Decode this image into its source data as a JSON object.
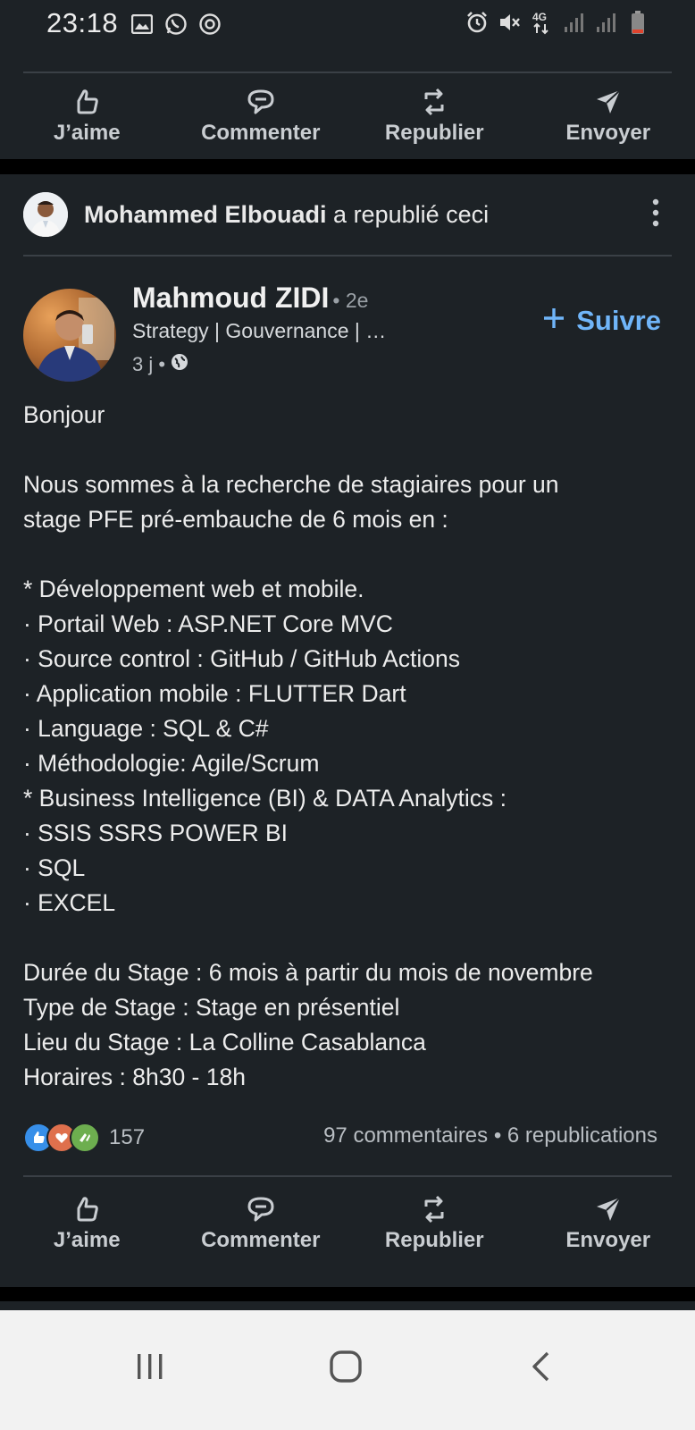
{
  "status_bar": {
    "time": "23:18",
    "left_icons": [
      "gallery-icon",
      "whatsapp-icon",
      "sync-icon"
    ],
    "right_icons": [
      "alarm-icon",
      "mute-icon",
      "4g-icon",
      "signal-icon",
      "signal-icon",
      "battery-icon"
    ],
    "network": "4G"
  },
  "top_actions": [
    {
      "label": "J’aime",
      "icon": "like-icon"
    },
    {
      "label": "Commenter",
      "icon": "comment-icon"
    },
    {
      "label": "Republier",
      "icon": "repost-icon"
    },
    {
      "label": "Envoyer",
      "icon": "send-icon"
    }
  ],
  "post": {
    "reposter_name": "Mohammed Elbouadi",
    "repost_text": "a republié ceci",
    "author_name": "Mahmoud ZIDI",
    "degree": "• 2e",
    "headline": "Strategy | Gouvernance | …",
    "age": "3 j •",
    "follow_label": "Suivre",
    "body": [
      "Bonjour",
      "",
      "Nous sommes à la recherche de stagiaires pour un",
      "stage PFE pré-embauche de 6 mois en :",
      "",
      "* Développement web et mobile.",
      "· Portail Web : ASP.NET Core MVC",
      "· Source control : GitHub / GitHub Actions",
      "· Application mobile : FLUTTER Dart",
      "· Language : SQL & C#",
      "· Méthodologie: Agile/Scrum",
      "* Business Intelligence (BI) & DATA Analytics :",
      "· SSIS SSRS POWER BI",
      "· SQL",
      "· EXCEL",
      "",
      "Durée du Stage : 6 mois à partir du mois de novembre",
      "Type de Stage : Stage en présentiel",
      "Lieu du Stage : La Colline Casablanca",
      "Horaires : 8h30 - 18h"
    ],
    "reaction_count": "157",
    "engagement": "97 commentaires • 6 republications"
  },
  "post_actions": [
    {
      "label": "J’aime",
      "icon": "like-icon"
    },
    {
      "label": "Commenter",
      "icon": "comment-icon"
    },
    {
      "label": "Republier",
      "icon": "repost-icon"
    },
    {
      "label": "Envoyer",
      "icon": "send-icon"
    }
  ],
  "nav_bar": [
    "recent-apps-icon",
    "home-icon",
    "back-icon"
  ],
  "colors": {
    "card_bg": "#1d2226",
    "accent": "#70b5f9",
    "nav_bg": "#f2f2f2"
  }
}
